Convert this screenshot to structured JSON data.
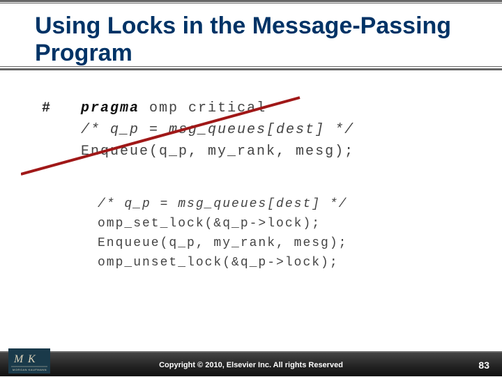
{
  "title": "Using Locks in the Message-Passing Program",
  "code_block_1": {
    "hash": "#",
    "pragma_bold": "pragma",
    "pragma_rest": " omp critical",
    "comment": "/* q_p = msg_queues[dest] */",
    "enqueue": "Enqueue(q_p, my_rank, mesg);"
  },
  "code_block_2": {
    "comment": "/* q_p = msg_queues[dest] */",
    "line1": "omp_set_lock(&q_p->lock);",
    "line2": "Enqueue(q_p, my_rank, mesg);",
    "line3": "omp_unset_lock(&q_p->lock);"
  },
  "footer": {
    "copyright": "Copyright © 2010, Elsevier Inc. All rights Reserved",
    "page": "83",
    "logo_text": "MK",
    "logo_sub": "MORGAN KAUFMANN"
  }
}
